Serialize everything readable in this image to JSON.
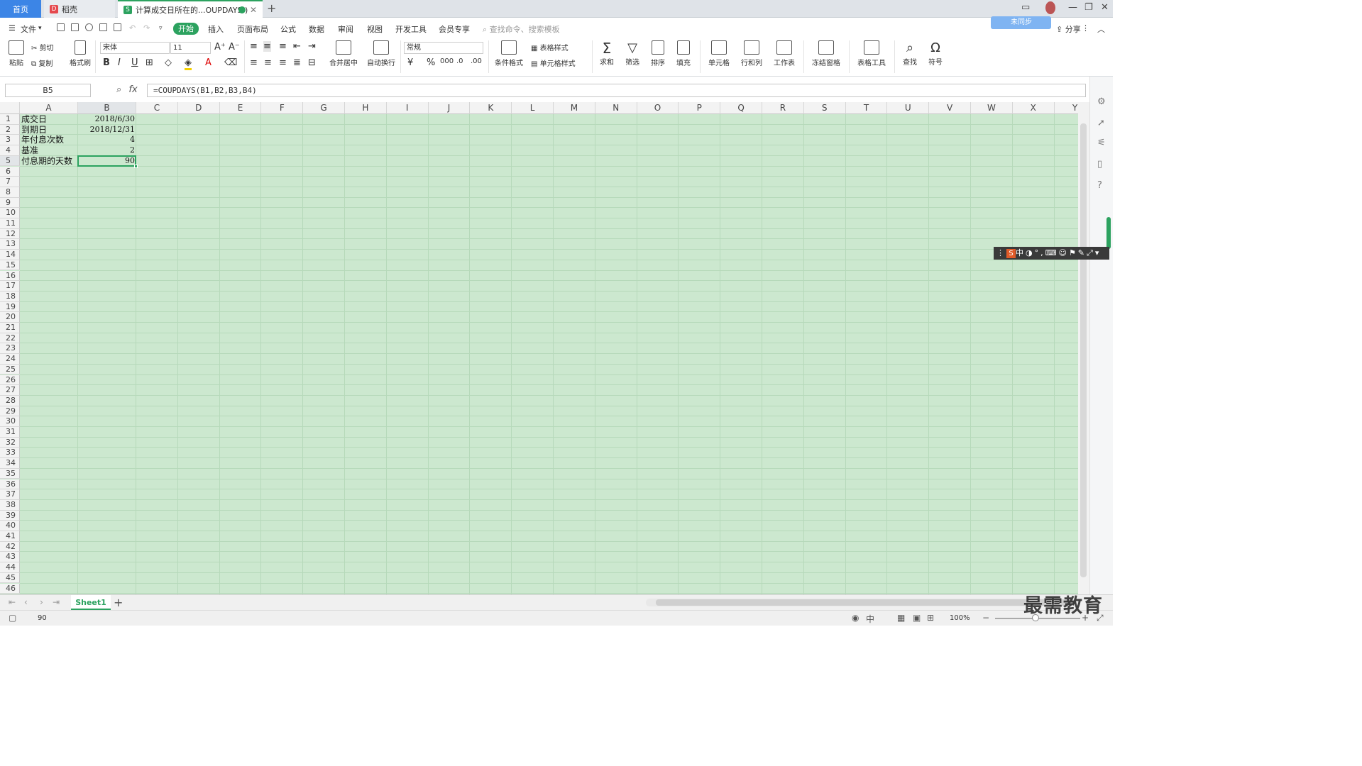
{
  "tabs": {
    "home": "首页",
    "doc1": "稻壳",
    "doc2": "计算成交日所在的...OUPDAYS )"
  },
  "menu": {
    "file": "文件",
    "start": "开始",
    "insert": "插入",
    "page_layout": "页面布局",
    "formulas": "公式",
    "data": "数据",
    "review": "审阅",
    "view": "视图",
    "developer": "开发工具",
    "member": "会员专享",
    "search_placeholder": "查找命令、搜索模板",
    "share": "分享",
    "cloud": "未同步"
  },
  "ribbon": {
    "paste": "粘贴",
    "cut": "剪切",
    "copy": "复制",
    "format_painter": "格式刷",
    "font_name": "宋体",
    "font_size": "11",
    "merge_center": "合并居中",
    "wrap_text": "自动换行",
    "number_format": "常规",
    "conditional_format": "条件格式",
    "table_style": "表格样式",
    "cell_style": "单元格样式",
    "sum": "求和",
    "filter": "筛选",
    "sort": "排序",
    "fill": "填充",
    "cell": "单元格",
    "row_col": "行和列",
    "worksheet": "工作表",
    "freeze": "冻结窗格",
    "table_tools": "表格工具",
    "find": "查找",
    "symbol": "符号"
  },
  "formula_bar": {
    "name_box": "B5",
    "fx": "fx",
    "formula": "=COUPDAYS(B1,B2,B3,B4)"
  },
  "columns": [
    "A",
    "B",
    "C",
    "D",
    "E",
    "F",
    "G",
    "H",
    "I",
    "J",
    "K",
    "L",
    "M",
    "N",
    "O",
    "P",
    "Q",
    "R",
    "S",
    "T",
    "U",
    "V",
    "W",
    "X",
    "Y"
  ],
  "rows": [
    {
      "a": "成交日",
      "b": "2018/6/30"
    },
    {
      "a": "到期日",
      "b": "2018/12/31"
    },
    {
      "a": "年付息次数",
      "b": "4"
    },
    {
      "a": "基准",
      "b": "2"
    },
    {
      "a": "付息期的天数",
      "b": "90"
    }
  ],
  "row_count": 46,
  "sheet": {
    "name": "Sheet1"
  },
  "status": {
    "value": "90",
    "zoom": "100%",
    "ime": "中"
  },
  "ime_bar": {
    "label": "中"
  },
  "watermark": "最需教育",
  "colors": {
    "accent": "#2ca25f",
    "grid_bg": "#cce8cf",
    "home_tab": "#3c85e6"
  }
}
